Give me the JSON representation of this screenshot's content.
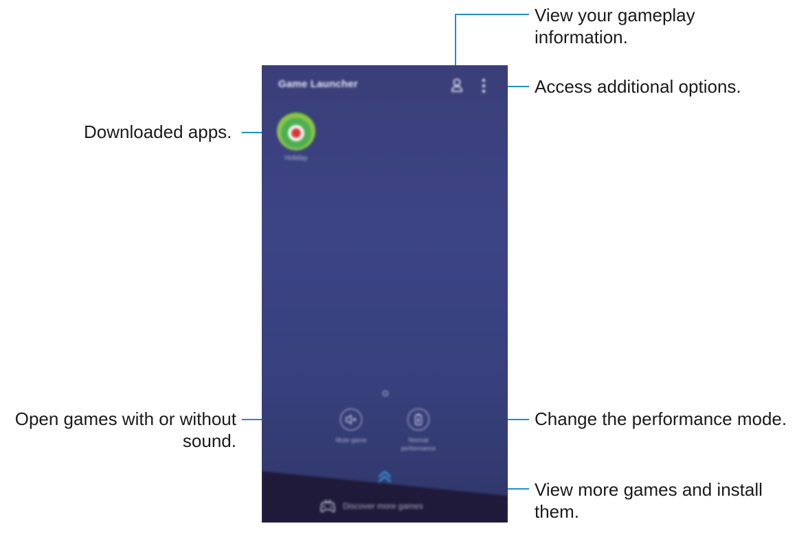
{
  "app": {
    "title": "Game Launcher"
  },
  "apps": [
    {
      "label": "Holiday",
      "icon": "app-game-icon"
    }
  ],
  "quick_settings": {
    "mute": {
      "label": "Mute game",
      "icon": "mute-speaker-icon"
    },
    "performance": {
      "label": "Normal\nperformance",
      "icon": "battery-performance-icon"
    }
  },
  "discover": {
    "label": "Discover more games",
    "icon": "gamepad-tv-icon"
  },
  "callouts": {
    "gameplay": "View your gameplay\ninformation.",
    "options": "Access additional options.",
    "downloaded": "Downloaded apps.",
    "sound": "Open games with or without\nsound.",
    "performance": "Change the performance mode.",
    "more_games": "View more games and install\nthem."
  },
  "colors": {
    "callout_line": "#1a8fc9",
    "accent": "#3aa3e0",
    "phone_bg": "#3c4486"
  }
}
